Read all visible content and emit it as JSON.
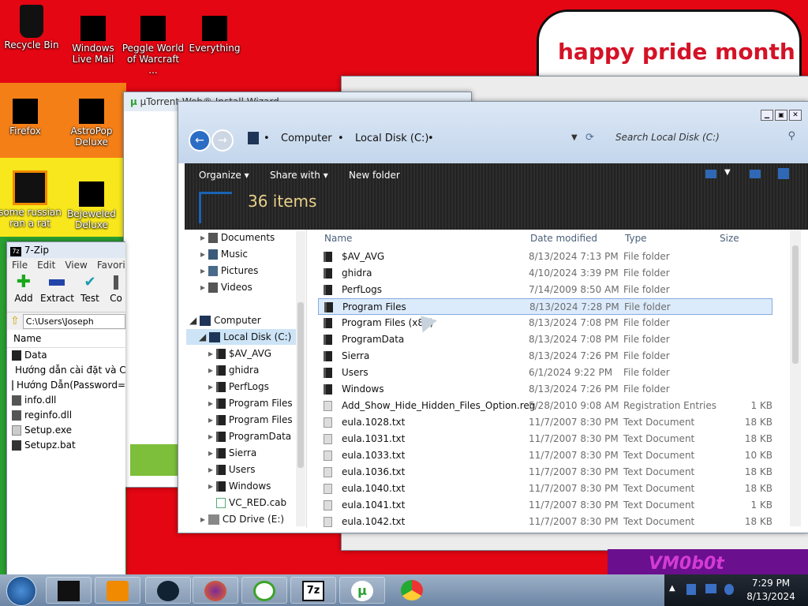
{
  "desktop": {
    "icons": [
      {
        "label": "Recycle Bin"
      },
      {
        "label": "Windows Live Mail"
      },
      {
        "label": "Peggle World of Warcraft ..."
      },
      {
        "label": "Everything"
      },
      {
        "label": "Firefox"
      },
      {
        "label": "AstroPop Deluxe"
      },
      {
        "label": "some russian ran a rat"
      },
      {
        "label": "Bejeweled Deluxe"
      }
    ],
    "banner": "happy pride month",
    "bottom_banner": "VM0b0t"
  },
  "utorrent": {
    "title": "µTorrent Web® Install Wizard"
  },
  "sevenzip": {
    "title": "7-Zip",
    "menu": [
      "File",
      "Edit",
      "View",
      "Favori"
    ],
    "tools": [
      {
        "label": "Add"
      },
      {
        "label": "Extract"
      },
      {
        "label": "Test"
      },
      {
        "label": "Co"
      }
    ],
    "path": "C:\\Users\\Joseph",
    "column": "Name",
    "files": [
      "Data",
      "Hướng dẫn cài đặt và C",
      "Hướng Dẫn(Password=",
      "info.dll",
      "reginfo.dll",
      "Setup.exe",
      "Setupz.bat"
    ]
  },
  "explorer": {
    "breadcrumb": [
      "Computer",
      "Local Disk (C:)"
    ],
    "search_placeholder": "Search Local Disk (C:)",
    "commands": {
      "organize": "Organize",
      "share": "Share with",
      "new_folder": "New folder"
    },
    "item_count": "36 items",
    "nav": [
      {
        "label": "Documents"
      },
      {
        "label": "Music"
      },
      {
        "label": "Pictures"
      },
      {
        "label": "Videos"
      },
      {
        "label": "Computer"
      },
      {
        "label": "Local Disk (C:)"
      },
      {
        "label": "$AV_AVG"
      },
      {
        "label": "ghidra"
      },
      {
        "label": "PerfLogs"
      },
      {
        "label": "Program Files"
      },
      {
        "label": "Program Files ("
      },
      {
        "label": "ProgramData"
      },
      {
        "label": "Sierra"
      },
      {
        "label": "Users"
      },
      {
        "label": "Windows"
      },
      {
        "label": "VC_RED.cab"
      },
      {
        "label": "CD Drive (E:)"
      }
    ],
    "columns": {
      "name": "Name",
      "date": "Date modified",
      "type": "Type",
      "size": "Size"
    },
    "files": [
      {
        "name": "$AV_AVG",
        "date": "8/13/2024 7:13 PM",
        "type": "File folder",
        "size": ""
      },
      {
        "name": "ghidra",
        "date": "4/10/2024 3:39 PM",
        "type": "File folder",
        "size": ""
      },
      {
        "name": "PerfLogs",
        "date": "7/14/2009 8:50 AM",
        "type": "File folder",
        "size": ""
      },
      {
        "name": "Program Files",
        "date": "8/13/2024 7:28 PM",
        "type": "File folder",
        "size": ""
      },
      {
        "name": "Program Files (x86)",
        "date": "8/13/2024 7:08 PM",
        "type": "File folder",
        "size": ""
      },
      {
        "name": "ProgramData",
        "date": "8/13/2024 7:08 PM",
        "type": "File folder",
        "size": ""
      },
      {
        "name": "Sierra",
        "date": "8/13/2024 7:26 PM",
        "type": "File folder",
        "size": ""
      },
      {
        "name": "Users",
        "date": "6/1/2024 9:22 PM",
        "type": "File folder",
        "size": ""
      },
      {
        "name": "Windows",
        "date": "8/13/2024 7:26 PM",
        "type": "File folder",
        "size": ""
      },
      {
        "name": "Add_Show_Hide_Hidden_Files_Option.reg",
        "date": "5/28/2010 9:08 AM",
        "type": "Registration Entries",
        "size": "1 KB"
      },
      {
        "name": "eula.1028.txt",
        "date": "11/7/2007 8:30 PM",
        "type": "Text Document",
        "size": "18 KB"
      },
      {
        "name": "eula.1031.txt",
        "date": "11/7/2007 8:30 PM",
        "type": "Text Document",
        "size": "18 KB"
      },
      {
        "name": "eula.1033.txt",
        "date": "11/7/2007 8:30 PM",
        "type": "Text Document",
        "size": "10 KB"
      },
      {
        "name": "eula.1036.txt",
        "date": "11/7/2007 8:30 PM",
        "type": "Text Document",
        "size": "18 KB"
      },
      {
        "name": "eula.1040.txt",
        "date": "11/7/2007 8:30 PM",
        "type": "Text Document",
        "size": "18 KB"
      },
      {
        "name": "eula.1041.txt",
        "date": "11/7/2007 8:30 PM",
        "type": "Text Document",
        "size": "1 KB"
      },
      {
        "name": "eula.1042.txt",
        "date": "11/7/2007 8:30 PM",
        "type": "Text Document",
        "size": "18 KB"
      }
    ],
    "selected_item": "Program Files"
  },
  "taskbar": {
    "items": [
      {
        "icon": "start-orb-icon"
      },
      {
        "icon": "terminal-icon"
      },
      {
        "icon": "media-player-icon"
      },
      {
        "icon": "globe-icon"
      },
      {
        "icon": "firefox-icon"
      },
      {
        "icon": "everything-icon"
      },
      {
        "icon": "7zip-icon"
      },
      {
        "icon": "utorrent-icon"
      },
      {
        "icon": "chrome-icon"
      }
    ],
    "time": "7:29 PM",
    "date": "8/13/2024"
  }
}
